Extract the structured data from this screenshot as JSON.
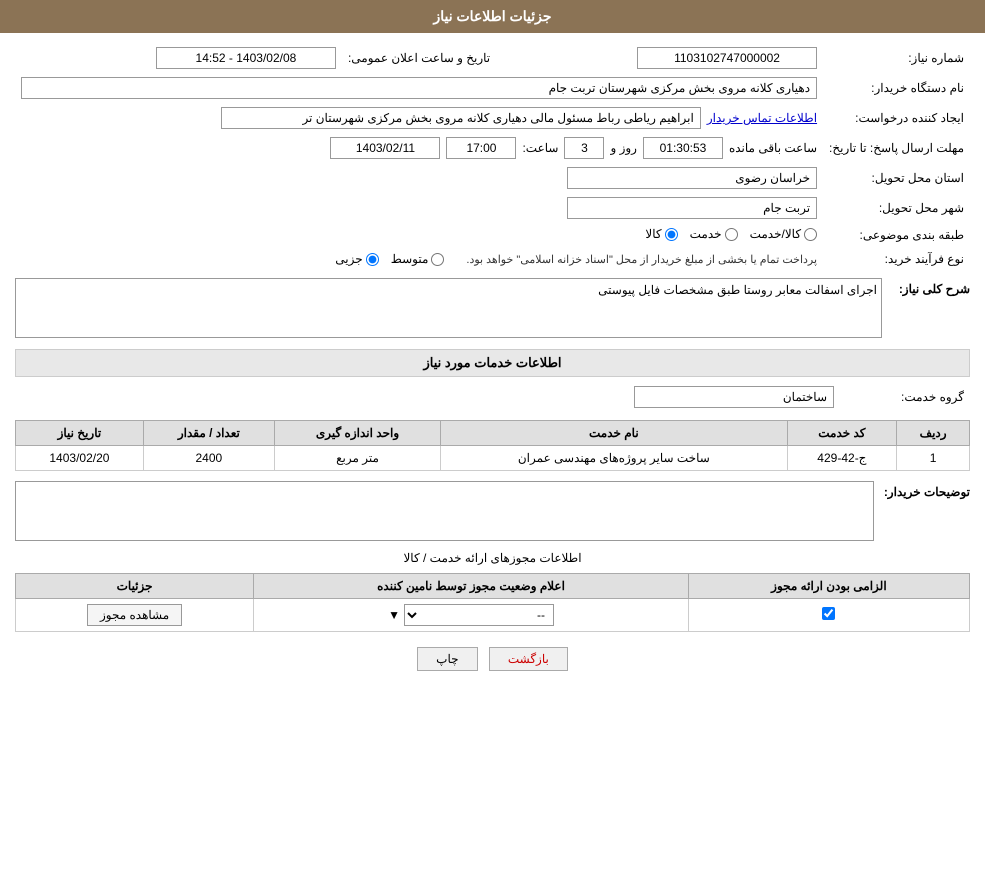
{
  "header": {
    "title": "جزئیات اطلاعات نیاز"
  },
  "fields": {
    "need_number_label": "شماره نیاز:",
    "need_number_value": "1103102747000002",
    "announce_date_label": "تاریخ و ساعت اعلان عمومی:",
    "announce_date_value": "1403/02/08 - 14:52",
    "buyer_org_label": "نام دستگاه خریدار:",
    "buyer_org_value": "دهیاری کلانه مروی بخش مرکزی شهرستان تربت جام",
    "requester_label": "ایجاد کننده درخواست:",
    "requester_value": "ابراهیم ریاطی رباط مسئول مالی دهیاری کلانه مروی بخش مرکزی شهرستان تر",
    "contact_link": "اطلاعات تماس خریدار",
    "deadline_label": "مهلت ارسال پاسخ: تا تاریخ:",
    "deadline_date": "1403/02/11",
    "deadline_time_label": "ساعت:",
    "deadline_time": "17:00",
    "deadline_days_label": "روز و",
    "deadline_days": "3",
    "deadline_remaining_label": "ساعت باقی مانده",
    "deadline_remaining": "01:30:53",
    "province_label": "استان محل تحویل:",
    "province_value": "خراسان رضوی",
    "city_label": "شهر محل تحویل:",
    "city_value": "تربت جام",
    "category_label": "طبقه بندی موضوعی:",
    "category_kala": "کالا",
    "category_khadamat": "خدمت",
    "category_kala_khadamat": "کالا/خدمت",
    "purchase_type_label": "نوع فرآیند خرید:",
    "purchase_jozyi": "جزیی",
    "purchase_motavaset": "متوسط",
    "purchase_note": "پرداخت تمام یا بخشی از مبلغ خریدار از محل \"اسناد خزانه اسلامی\" خواهد بود.",
    "need_desc_label": "شرح کلی نیاز:",
    "need_desc_value": "اجرای اسفالت معابر روستا طبق مشخصات فایل پیوستی",
    "services_section_title": "اطلاعات خدمات مورد نیاز",
    "service_group_label": "گروه خدمت:",
    "service_group_value": "ساختمان",
    "table_headers": {
      "row": "ردیف",
      "code": "کد خدمت",
      "name": "نام خدمت",
      "unit": "واحد اندازه گیری",
      "quantity": "تعداد / مقدار",
      "date": "تاریخ نیاز"
    },
    "table_rows": [
      {
        "row": "1",
        "code": "ج-42-429",
        "name": "ساخت سایر پروژه‌های مهندسی عمران",
        "unit": "متر مربع",
        "quantity": "2400",
        "date": "1403/02/20"
      }
    ],
    "buyer_notes_label": "توضیحات خریدار:",
    "buyer_notes_value": "",
    "permits_section_title": "اطلاعات مجوزهای ارائه خدمت / کالا",
    "permits_table_headers": {
      "required": "الزامی بودن ارائه مجوز",
      "status": "اعلام وضعیت مجوز توسط نامین کننده",
      "details": "جزئیات"
    },
    "permits_rows": [
      {
        "required": true,
        "status": "--",
        "details_btn": "مشاهده مجوز"
      }
    ]
  },
  "buttons": {
    "print": "چاپ",
    "back": "بازگشت",
    "view_permit": "مشاهده مجوز"
  }
}
